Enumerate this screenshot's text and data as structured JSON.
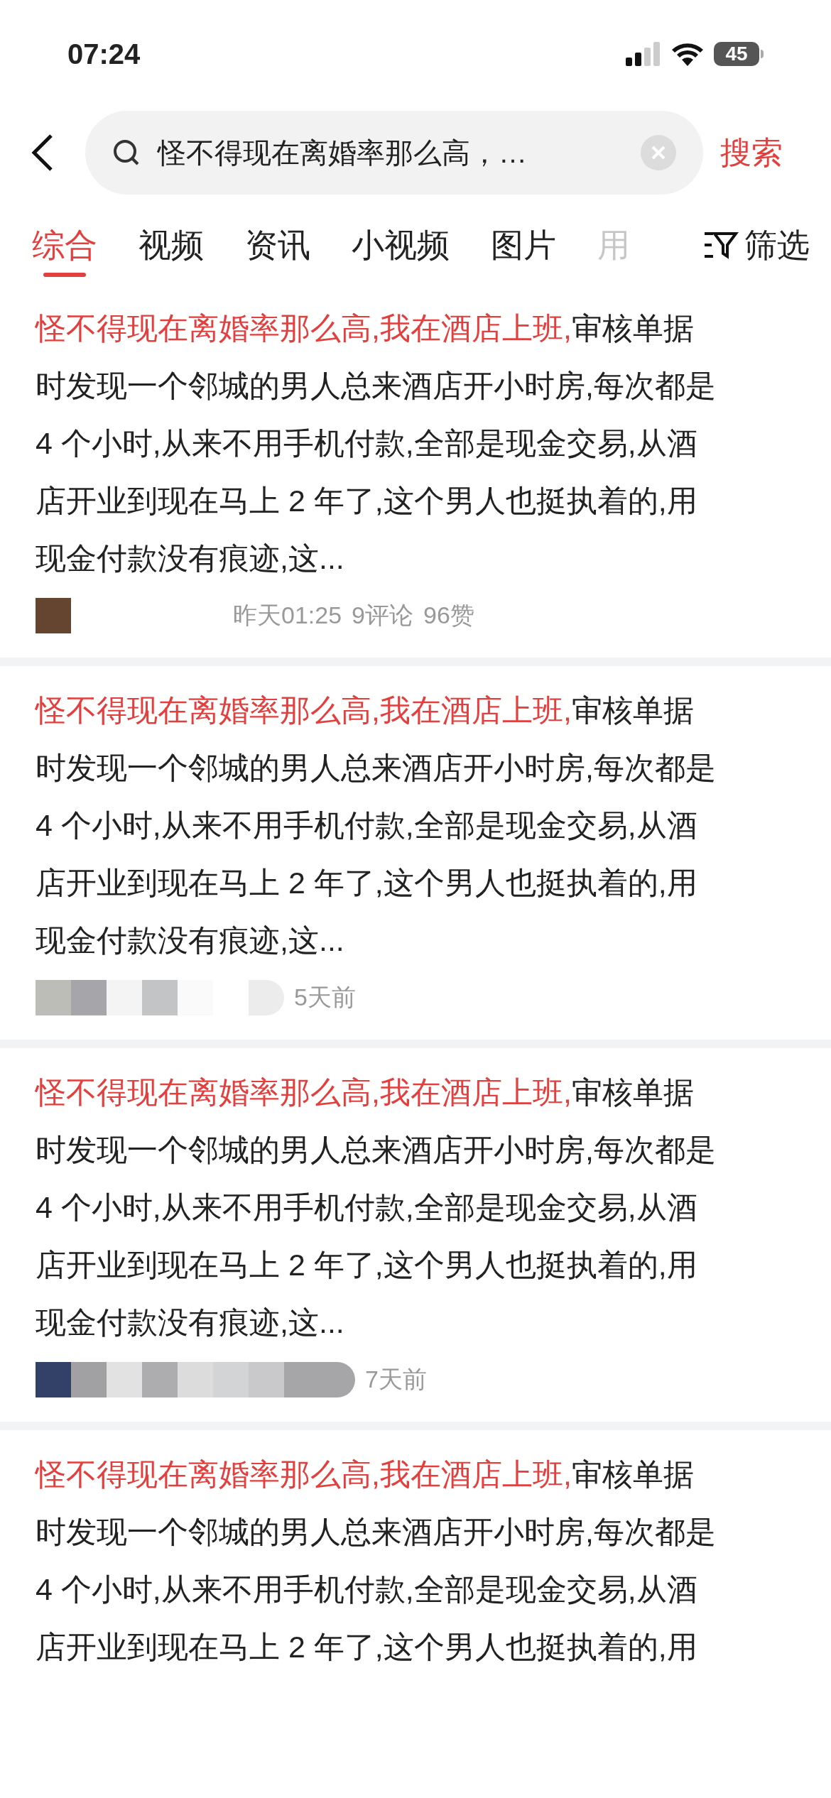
{
  "status_bar": {
    "time": "07:24",
    "battery": "45"
  },
  "search": {
    "value": "怪不得现在离婚率那么高，…",
    "action": "搜索"
  },
  "tabs": [
    {
      "label": "综合",
      "selected": true,
      "faded": false
    },
    {
      "label": "视频",
      "selected": false,
      "faded": false
    },
    {
      "label": "资讯",
      "selected": false,
      "faded": false
    },
    {
      "label": "小视频",
      "selected": false,
      "faded": false
    },
    {
      "label": "图片",
      "selected": false,
      "faded": false
    },
    {
      "label": "用",
      "selected": false,
      "faded": true
    }
  ],
  "filter": {
    "label": "筛选"
  },
  "results": [
    {
      "highlight": "怪不得现在离婚率那么高,我在酒店上班,",
      "lines": [
        "审核单据",
        "时发现一个邻城的男人总来酒店开小时房,每次都是",
        "4 个小时,从来不用手机付款,全部是现金交易,从酒",
        "店开业到现在马上 2 年了,这个男人也挺执着的,用",
        "现金付款没有痕迹,这..."
      ],
      "avatar": {
        "kind": "square"
      },
      "meta": [
        "昨天01:25",
        "9评论",
        "96赞"
      ]
    },
    {
      "highlight": "怪不得现在离婚率那么高,我在酒店上班,",
      "lines": [
        "审核单据",
        "时发现一个邻城的男人总来酒店开小时房,每次都是",
        "4 个小时,从来不用手机付款,全部是现金交易,从酒",
        "店开业到现在马上 2 年了,这个男人也挺执着的,用",
        "现金付款没有痕迹,这..."
      ],
      "avatar": {
        "kind": "mosaic"
      },
      "meta": [
        "5天前"
      ]
    },
    {
      "highlight": "怪不得现在离婚率那么高,我在酒店上班,",
      "lines": [
        "审核单据",
        "时发现一个邻城的男人总来酒店开小时房,每次都是",
        "4 个小时,从来不用手机付款,全部是现金交易,从酒",
        "店开业到现在马上 2 年了,这个男人也挺执着的,用",
        "现金付款没有痕迹,这..."
      ],
      "avatar": {
        "kind": "mosaic-wide"
      },
      "meta": [
        "7天前"
      ]
    },
    {
      "highlight": "怪不得现在离婚率那么高,我在酒店上班,",
      "lines": [
        "审核单据",
        "时发现一个邻城的男人总来酒店开小时房,每次都是",
        "4 个小时,从来不用手机付款,全部是现金交易,从酒",
        "店开业到现在马上 2 年了,这个男人也挺执着的,用"
      ]
    }
  ]
}
